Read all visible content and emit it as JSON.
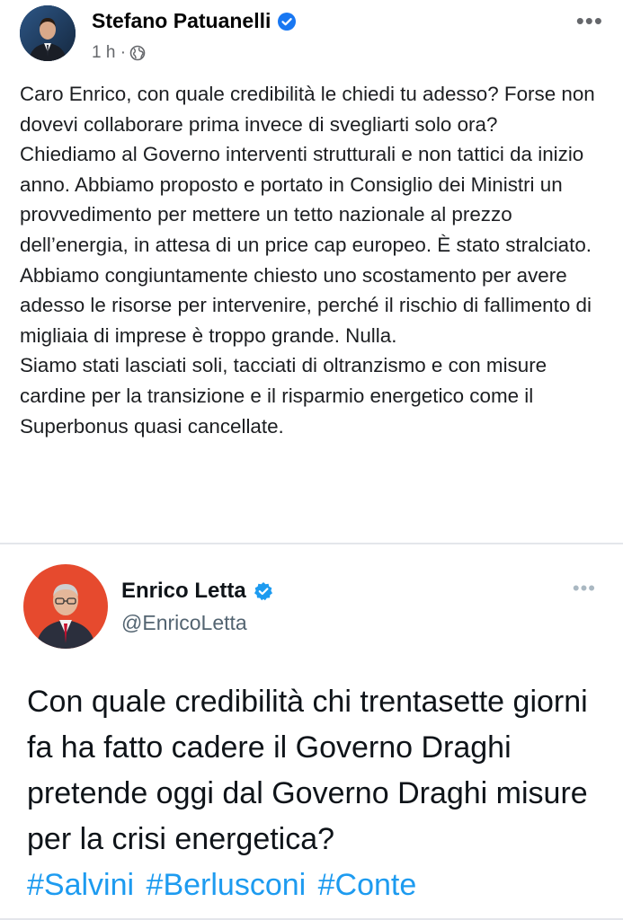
{
  "post": {
    "author": "Stefano Patuanelli",
    "time": "1 h ·",
    "paragraphs": [
      "Caro Enrico, con quale credibilità le chiedi tu adesso? Forse non dovevi collaborare prima invece di svegliarti solo ora?",
      "Chiediamo al Governo interventi strutturali e non tattici da inizio anno. Abbiamo proposto e portato in Consiglio dei Ministri un provvedimento per mettere un tetto nazionale al prezzo dell’energia, in attesa di un price cap europeo. È stato stralciato.",
      "Abbiamo congiuntamente chiesto uno scostamento per avere adesso le risorse per intervenire, perché il rischio di fallimento di migliaia di imprese è troppo grande. Nulla.",
      "Siamo stati lasciati soli, tacciati di oltranzismo e con misure cardine per la transizione e il risparmio energetico come il Superbonus quasi cancellate."
    ],
    "more_icon": "ellipsis-icon",
    "privacy_icon": "globe-icon"
  },
  "tweet": {
    "name": "Enrico Letta",
    "handle": "@EnricoLetta",
    "text": "Con quale credibilità chi trentasette giorni fa ha fatto cadere il Governo Draghi pretende oggi dal Governo Draghi misure per la crisi energetica?",
    "hashtags": [
      "#Salvini",
      "#Berlusconi",
      "#Conte"
    ],
    "more_icon": "ellipsis-icon"
  },
  "colors": {
    "verified_facebook": "#1877f2",
    "verified_twitter": "#1d9bf0",
    "hashtag": "#1d9bf0",
    "meta_text": "#65676b"
  }
}
